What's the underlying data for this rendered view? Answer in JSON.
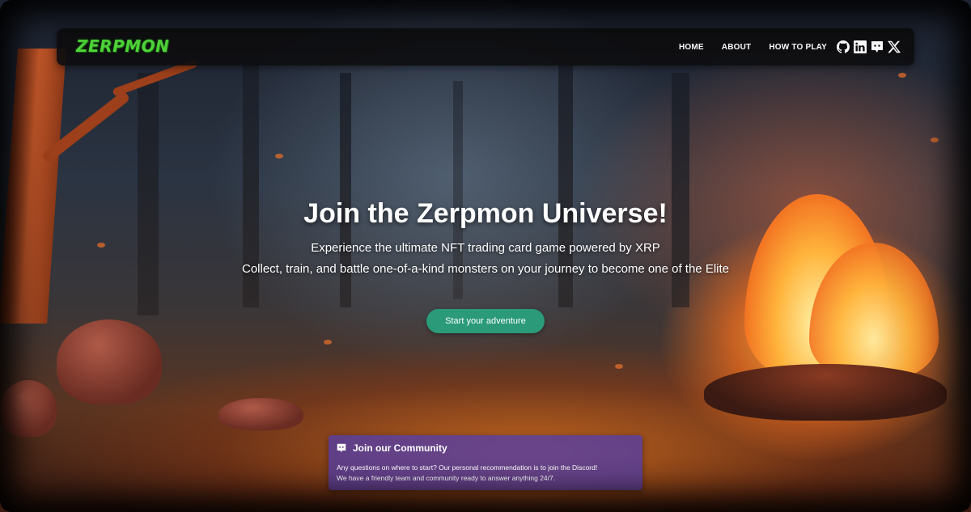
{
  "nav": {
    "logo": "ZERPMON",
    "links": [
      "HOME",
      "ABOUT",
      "HOW TO PLAY"
    ],
    "social_icons": [
      "github-icon",
      "linkedin-icon",
      "discord-icon",
      "x-icon"
    ]
  },
  "hero": {
    "title": "Join the Zerpmon Universe!",
    "subtitle_1": "Experience the ultimate NFT trading card game powered by XRP",
    "subtitle_2": "Collect, train, and battle one-of-a-kind monsters on your journey to become one of the Elite",
    "cta_label": "Start your adventure"
  },
  "community": {
    "icon": "discord-icon",
    "title": "Join our Community",
    "line_1": "Any questions on where to start? Our personal recommendation is to join the Discord!",
    "line_2": "We have a friendly team and community ready to answer anything 24/7."
  },
  "colors": {
    "logo": "#4fd63a",
    "navbar_bg": "#0e0e10",
    "cta_bg": "#2a9a78",
    "community_bg": "#583ea0"
  }
}
